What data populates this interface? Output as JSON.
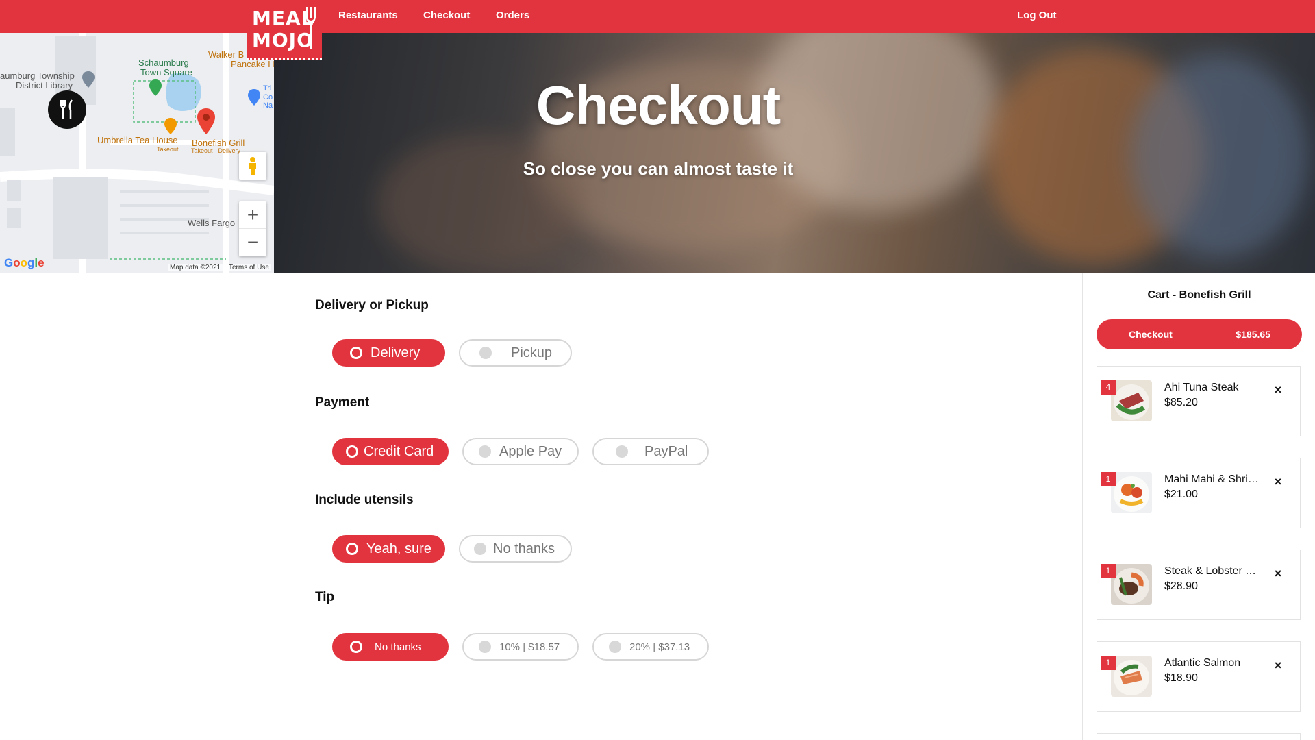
{
  "nav": {
    "logo_line1": "MEAL",
    "logo_line2": "MOJO",
    "links": [
      "Restaurants",
      "Checkout",
      "Orders"
    ],
    "logout": "Log Out",
    "accent": "#e1343f"
  },
  "map": {
    "labels": {
      "library": "aumburg Township",
      "library2": "District Library",
      "town_square": "Schaumburg",
      "town_square2": "Town Square",
      "walker": "Walker B",
      "walker2": "Pancake H",
      "tea": "Umbrella Tea House",
      "tea_sub": "Takeout",
      "bonefish": "Bonefish Grill",
      "bonefish_sub": "Takeout · Delivery",
      "wells": "Wells Fargo",
      "tri": "Tri",
      "tri2": "Co",
      "tri3": "Na"
    },
    "zoom_in": "+",
    "zoom_out": "−",
    "google": "Google",
    "map_data": "Map data ©2021",
    "terms": "Terms of Use"
  },
  "hero": {
    "title": "Checkout",
    "subtitle": "So close you can almost taste it"
  },
  "form": {
    "delivery": {
      "title": "Delivery or Pickup",
      "options": [
        "Delivery",
        "Pickup"
      ],
      "selected": "Delivery"
    },
    "payment": {
      "title": "Payment",
      "options": [
        "Credit Card",
        "Apple Pay",
        "PayPal"
      ],
      "selected": "Credit Card"
    },
    "utensils": {
      "title": "Include utensils",
      "options": [
        "Yeah, sure",
        "No thanks"
      ],
      "selected": "Yeah, sure"
    },
    "tip": {
      "title": "Tip",
      "options": [
        "No thanks",
        "10% | $18.57",
        "20% | $37.13"
      ],
      "selected": "No thanks"
    }
  },
  "cart": {
    "title": "Cart - Bonefish Grill",
    "checkout_label": "Checkout",
    "checkout_total": "$185.65",
    "remove_icon": "×",
    "items": [
      {
        "qty": "4",
        "name": "Ahi Tuna Steak",
        "price": "$85.20"
      },
      {
        "qty": "1",
        "name": "Mahi Mahi & Shrimp",
        "price": "$21.00"
      },
      {
        "qty": "1",
        "name": "Steak & Lobster Tail",
        "price": "$28.90"
      },
      {
        "qty": "1",
        "name": "Atlantic Salmon",
        "price": "$18.90"
      }
    ]
  }
}
